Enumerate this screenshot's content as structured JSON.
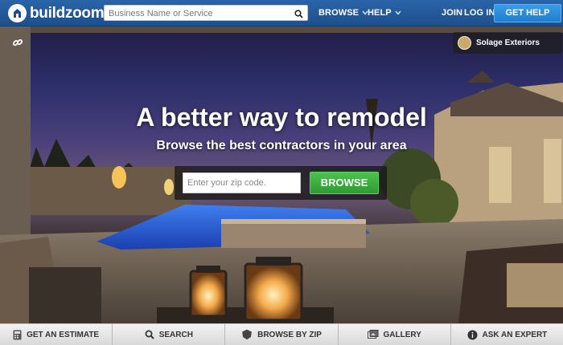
{
  "brand": {
    "name": "buildzoom"
  },
  "search": {
    "placeholder": "Business Name or Service"
  },
  "nav": {
    "browse": "BROWSE",
    "help": "HELP",
    "join": "JOIN",
    "login": "LOG IN",
    "get_help": "GET HELP"
  },
  "hero": {
    "title": "A better way to remodel",
    "subtitle": "Browse the best contractors in your area",
    "zip_placeholder": "Enter your zip code.",
    "browse_button": "BROWSE",
    "credit": "Solage Exteriors"
  },
  "bottom_nav": [
    {
      "label": "GET AN ESTIMATE",
      "icon": "calculator-icon"
    },
    {
      "label": "SEARCH",
      "icon": "search-icon"
    },
    {
      "label": "BROWSE BY ZIP",
      "icon": "zip-badge-icon"
    },
    {
      "label": "GALLERY",
      "icon": "gallery-icon"
    },
    {
      "label": "ASK AN EXPERT",
      "icon": "info-icon"
    }
  ],
  "colors": {
    "topbar": "#1d4f8c",
    "get_help": "#1f7fcc",
    "browse_green": "#2e9a33"
  }
}
